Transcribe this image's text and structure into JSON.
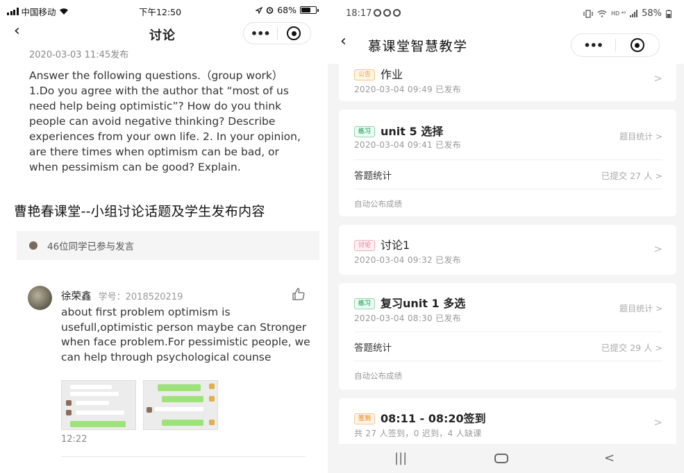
{
  "left": {
    "status": {
      "carrier": "中国移动",
      "time": "下午12:50",
      "battery": "68%"
    },
    "nav": {
      "back": "‹",
      "title": "讨论"
    },
    "date": "2020-03-03 11:45发布",
    "body": "Answer the following questions.（group work） 1.Do you agree with the author that “most of us need help being optimistic”? How do you think people can avoid negative thinking? Describe experiences from your own life. 2. In your opinion, are there times when optimism can be bad, or when pessimism can be good? Explain.",
    "caption": "曹艳春课堂--小组讨论话题及学生发布内容",
    "joined": "46位同学已参与发言",
    "post": {
      "name": "徐荣鑫",
      "student_id": "学号：2018520219",
      "text": "about first problem optimism is usefull,optimistic person maybe can Stronger when face problem.For pessimistic people, we can help through psychological counse",
      "time": "12:22"
    }
  },
  "right": {
    "status": {
      "time": "18:17",
      "network": "HD ⁴⁶",
      "battery": "58%"
    },
    "nav": {
      "back": "‹",
      "title": "慕课堂智慧教学"
    },
    "cards": [
      {
        "tag": "公告",
        "title": "作业",
        "date": "2020-03-04 09:49 已发布",
        "chevron": ">"
      },
      {
        "tag": "练习",
        "title": "unit 5 选择",
        "date": "2020-03-04 09:41 已发布",
        "stat": "题目统计 >",
        "row_label": "答题统计",
        "row_value": "已提交 27 人 >",
        "footer": "自动公布成绩"
      },
      {
        "tag": "讨论",
        "title": "讨论1",
        "date": "2020-03-04 09:32 已发布",
        "chevron": ">"
      },
      {
        "tag": "练习",
        "title": "复习unit 1 多选",
        "date": "2020-03-04 08:30 已发布",
        "stat": "题目统计 >",
        "row_label": "答题统计",
        "row_value": "已提交 29 人 >",
        "footer": "自动公布成绩"
      },
      {
        "tag": "签到",
        "title": "08:11 - 08:20签到",
        "date": "共 27 人签到，0 迟到，4 人缺课",
        "chevron": ">"
      }
    ],
    "bottom": {
      "recents": "|||",
      "back": "<"
    }
  },
  "colors": {
    "tag_notice": "#e6a23c",
    "tag_exercise": "#42b87b",
    "tag_discuss": "#e66a8b",
    "tag_checkin": "#f0a046"
  }
}
